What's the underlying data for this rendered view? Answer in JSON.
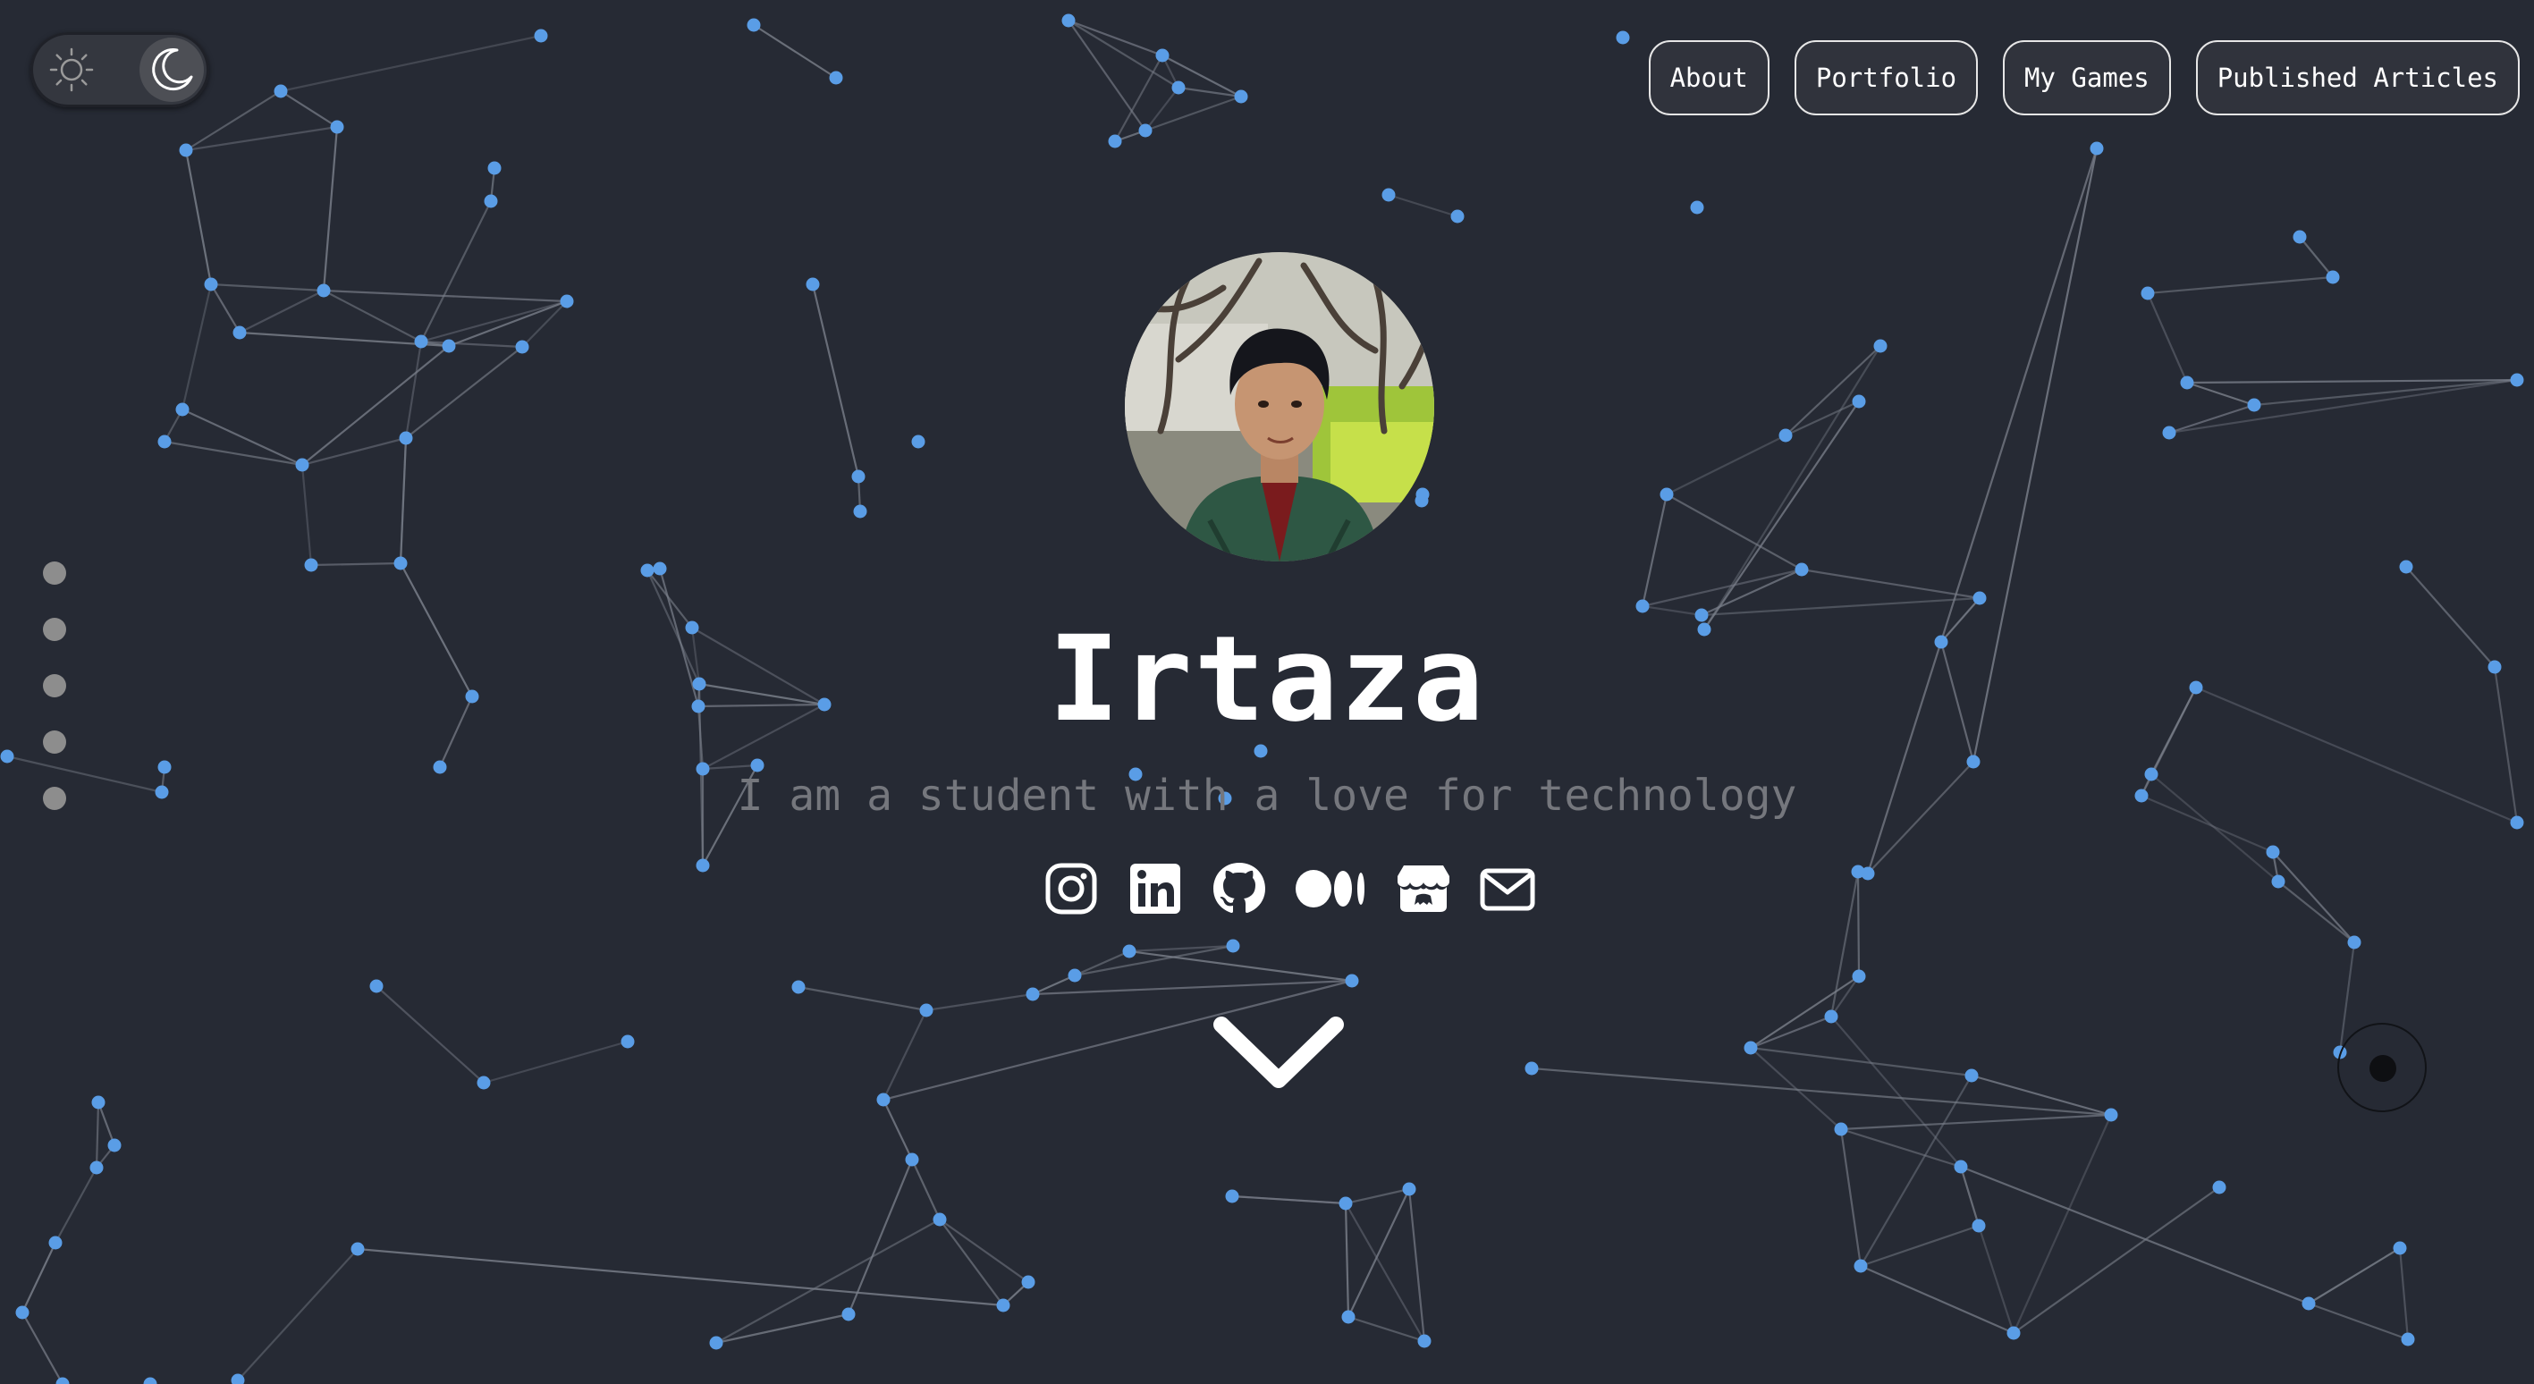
{
  "theme_toggle": {
    "mode": "dark",
    "off_icon": "sun-icon",
    "on_icon": "moon-icon"
  },
  "nav": {
    "items": [
      {
        "label": "About"
      },
      {
        "label": "Portfolio"
      },
      {
        "label": "My Games"
      },
      {
        "label": "Published Articles"
      }
    ]
  },
  "section_dots": {
    "count": 5,
    "color": "#8d8d8d"
  },
  "profile": {
    "name": "Irtaza",
    "tagline": "I am a student with a love for technology",
    "avatar_icon": "profile-photo"
  },
  "socials": [
    {
      "icon": "instagram-icon"
    },
    {
      "icon": "linkedin-icon"
    },
    {
      "icon": "github-icon"
    },
    {
      "icon": "medium-icon"
    },
    {
      "icon": "itchio-icon"
    },
    {
      "icon": "mail-icon"
    }
  ],
  "scroll_icon": "chevron-down-icon",
  "colors": {
    "background": "#262a34",
    "node": "#5a9de6",
    "edge": "#7a7f8a",
    "text": "#ffffff",
    "tagline": "#75777d"
  }
}
